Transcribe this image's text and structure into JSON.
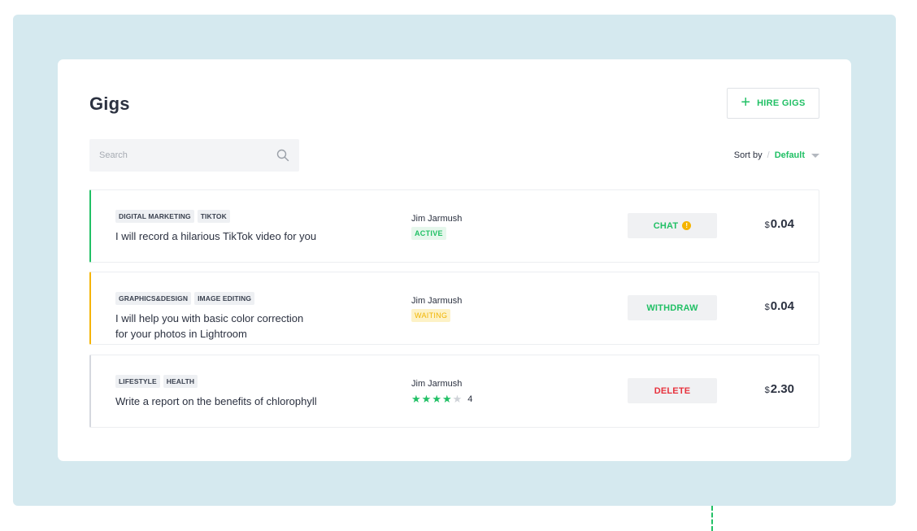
{
  "page": {
    "title": "Gigs"
  },
  "toolbar": {
    "hire_label": "HIRE GIGS",
    "hire_icon": "plus-icon"
  },
  "search": {
    "placeholder": "Search",
    "value": "",
    "icon": "search-icon"
  },
  "sort": {
    "label": "Sort by",
    "separator": "/",
    "value": "Default"
  },
  "gigs": [
    {
      "tags": [
        "DIGITAL MARKETING",
        "TIKTOK"
      ],
      "title": "I will record a hilarious TikTok video for you",
      "owner": "Jim Jarmush",
      "status": "ACTIVE",
      "action": "CHAT",
      "action_badge": "!",
      "currency": "$",
      "price": "0.04",
      "accent": "#21c065"
    },
    {
      "tags": [
        "GRAPHICS&DESIGN",
        "IMAGE EDITING"
      ],
      "title_lines": [
        "I will help you with basic color correction",
        "for your photos in Lightroom"
      ],
      "owner": "Jim Jarmush",
      "status": "WAITING",
      "action": "WITHDRAW",
      "currency": "$",
      "price": "0.04",
      "accent": "#f5b400"
    },
    {
      "tags": [
        "LIFESTYLE",
        "HEALTH"
      ],
      "title": "Write a report on the benefits of chlorophyll",
      "owner": "Jim Jarmush",
      "rating": 4,
      "rating_max": 5,
      "rating_text": "4",
      "action": "DELETE",
      "currency": "$",
      "price": "2.30",
      "accent": "#d5d8df"
    }
  ],
  "colors": {
    "brand_green": "#21c065",
    "warning": "#f5b400",
    "danger": "#e7323d",
    "background": "#d5e9ef"
  }
}
